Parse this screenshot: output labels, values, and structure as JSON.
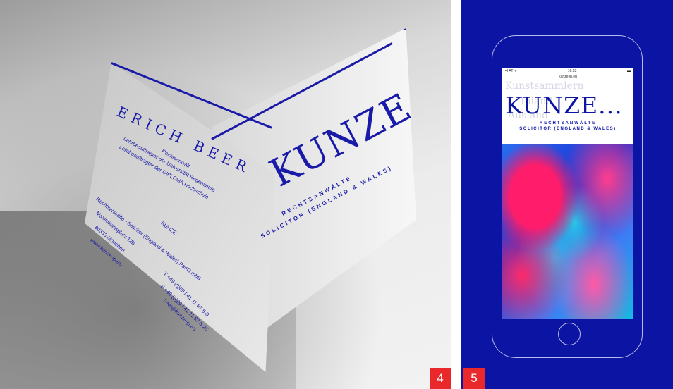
{
  "figure_left": {
    "card_front": {
      "name": "ERICH BEER",
      "title": "Rechtsanwalt",
      "line1": "Lehrbeauftragter der Universität Regensburg",
      "line2": "Lehrbeauftragter der DIPLOMA Hochschule",
      "firm_label": "KUNZE",
      "firm_line": "Rechtsanwälte • Solicitor (England & Wales) PartG mbB",
      "address1": "Maximiliansplatz 12b",
      "address2": "80333 München",
      "web": "www.kunze-ip.eu",
      "phone": "T +49 (0)89 / 41 11 87 5-0",
      "fax": "F +49 (0)89 / 41 11 87 5-25",
      "email": "beer@kunze-ip.eu"
    },
    "card_back": {
      "logo": "KUNZE",
      "sub1": "RECHTSANWÄLTE",
      "sub2": "SOLICITOR (ENGLAND & WALES)"
    },
    "label": "4"
  },
  "figure_right": {
    "status": {
      "left": "•ıl AT ᯤ",
      "time": "16:53",
      "right": "▬"
    },
    "url": "kunze-ip.eu",
    "ghost_words": [
      "Kunstsammlern",
      "Inland",
      "Ausland"
    ],
    "logo": "KUNZE...",
    "sub1": "RECHTSANWÄLTE",
    "sub2": "SOLICITOR (ENGLAND & WALES)",
    "label": "5"
  },
  "colors": {
    "brand_blue": "#0c14a3",
    "label_red": "#e8282a"
  }
}
